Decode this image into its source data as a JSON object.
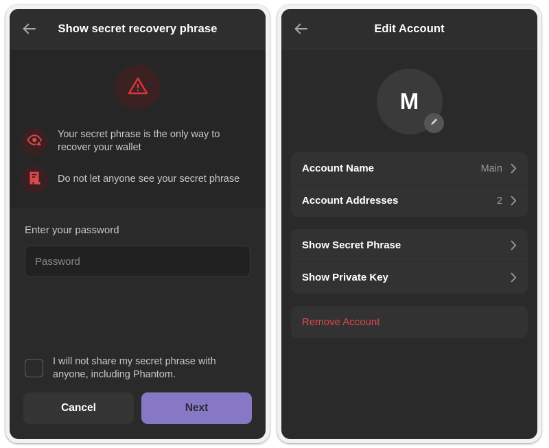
{
  "theme": {
    "accent_purple": "#8678c4",
    "danger_red": "#e0474c",
    "screen_bg": "#2a2a2a",
    "header_bg": "#2e2e2e",
    "card_bg": "#323232"
  },
  "left_screen": {
    "header": {
      "title": "Show secret recovery phrase",
      "back_icon": "arrow-left-icon"
    },
    "warning": {
      "badge_icon": "warning-triangle-icon",
      "items": [
        {
          "icon": "eye-warning-icon",
          "text": "Your secret phrase is the only way to recover your wallet"
        },
        {
          "icon": "document-icon",
          "text": "Do not let anyone see your secret phrase"
        }
      ]
    },
    "password": {
      "label": "Enter your password",
      "placeholder": "Password",
      "value": ""
    },
    "agreement": {
      "checked": false,
      "text": "I will not share my secret phrase with anyone, including Phantom."
    },
    "buttons": {
      "cancel": "Cancel",
      "next": "Next"
    }
  },
  "right_screen": {
    "header": {
      "title": "Edit Account",
      "back_icon": "arrow-left-icon"
    },
    "avatar": {
      "initial": "M",
      "edit_icon": "pencil-icon"
    },
    "groups": [
      {
        "rows": [
          {
            "label": "Account Name",
            "value": "Main",
            "chevron": "chevron-right-icon"
          },
          {
            "label": "Account Addresses",
            "value": "2",
            "chevron": "chevron-right-icon"
          }
        ]
      },
      {
        "rows": [
          {
            "label": "Show Secret Phrase",
            "value": "",
            "chevron": "chevron-right-icon"
          },
          {
            "label": "Show Private Key",
            "value": "",
            "chevron": "chevron-right-icon"
          }
        ]
      },
      {
        "rows": [
          {
            "label": "Remove Account",
            "value": "",
            "chevron": ""
          }
        ]
      }
    ]
  }
}
